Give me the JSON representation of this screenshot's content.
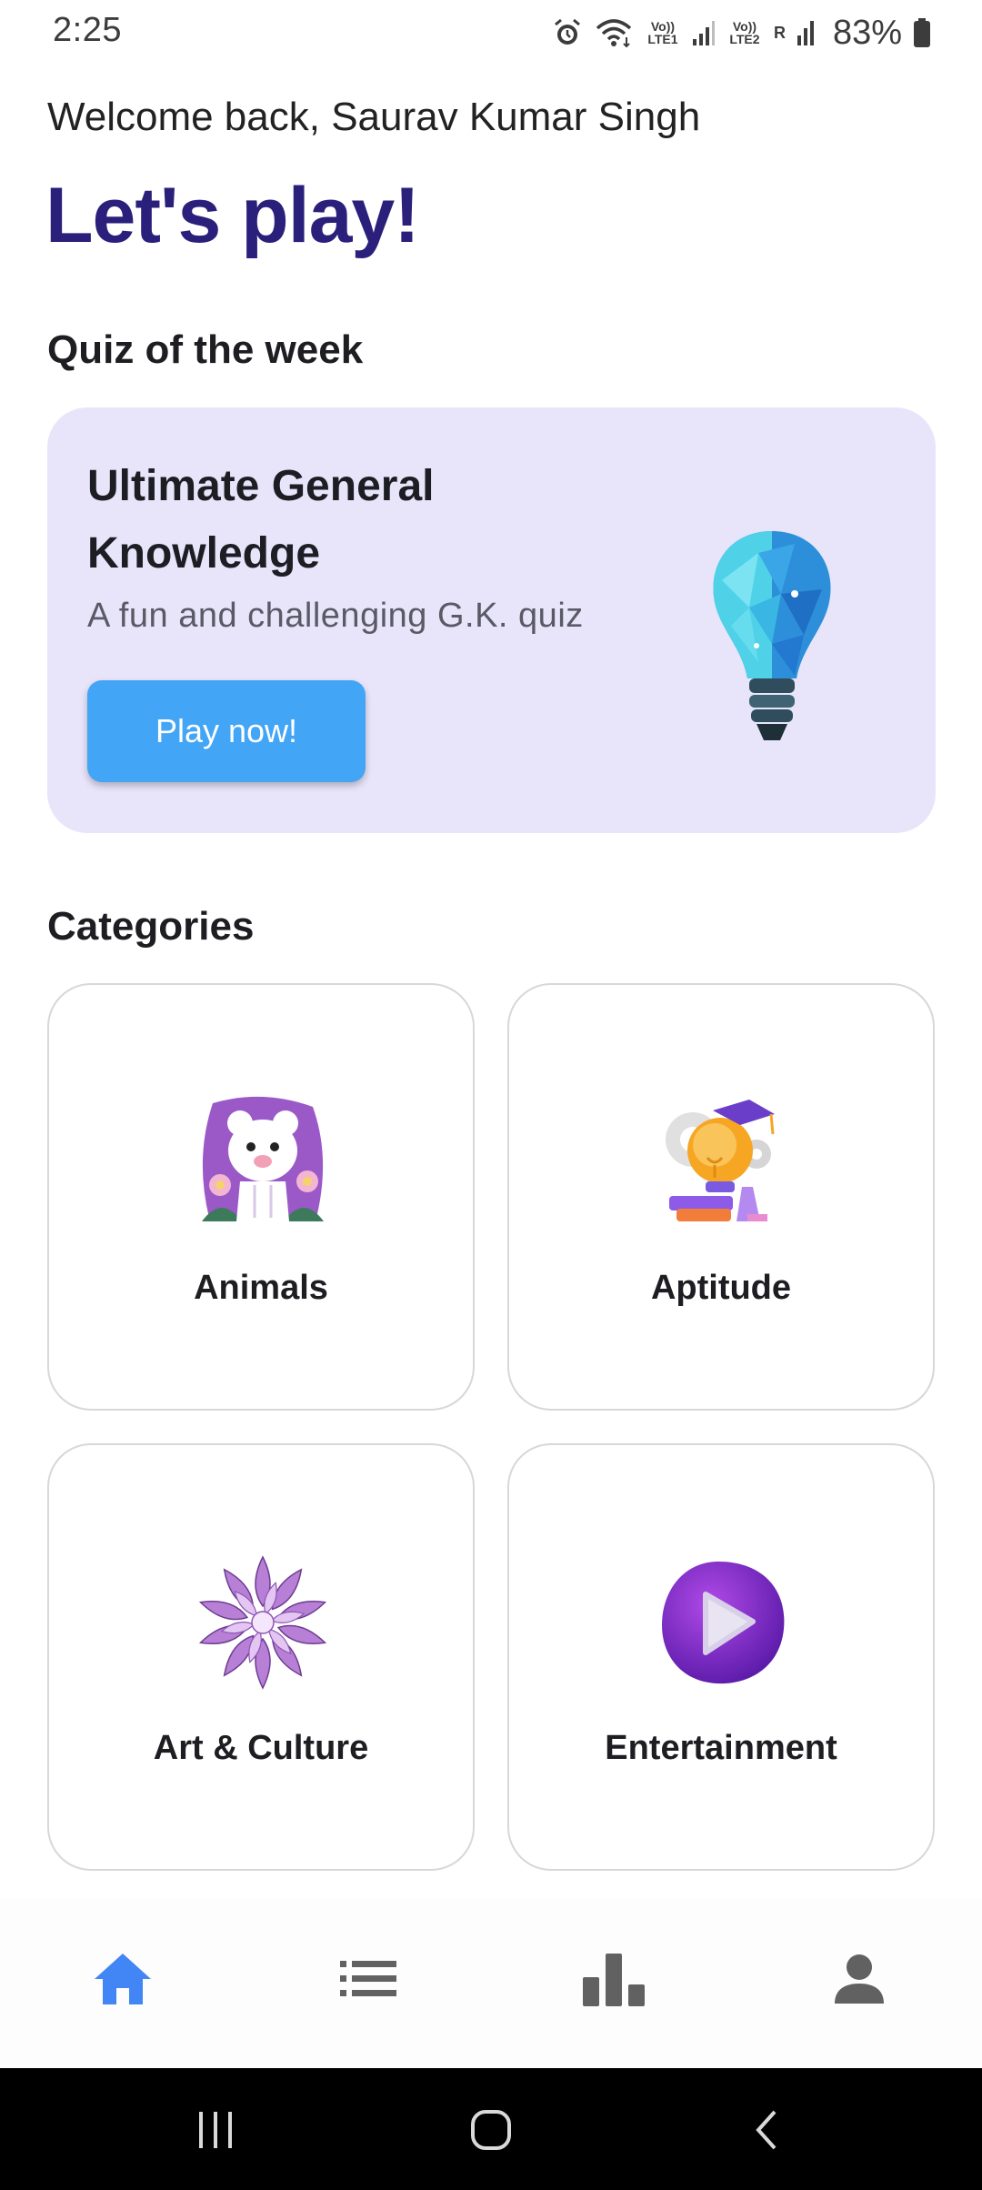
{
  "status_bar": {
    "time": "2:25",
    "sim1_tag": "Vo)) LTE1",
    "sim2_tag": "Vo)) LTE2",
    "roaming": "R",
    "battery": "83%",
    "icons": [
      "alarm-icon",
      "wifi-icon",
      "signal-icon",
      "battery-icon"
    ]
  },
  "header": {
    "welcome": "Welcome back, Saurav Kumar Singh",
    "headline": "Let's play!"
  },
  "quiz_of_week": {
    "section_title": "Quiz of the week",
    "title": "Ultimate General Knowledge",
    "description": "A fun and challenging G.K. quiz",
    "button_label": "Play now!",
    "art": "lightbulb-illustration"
  },
  "categories": {
    "section_title": "Categories",
    "items": [
      {
        "label": "Animals",
        "art": "bear-illustration"
      },
      {
        "label": "Aptitude",
        "art": "lightbulb-graduation-illustration"
      },
      {
        "label": "Art & Culture",
        "art": "lotus-illustration"
      },
      {
        "label": "Entertainment",
        "art": "play-button-illustration"
      }
    ]
  },
  "bottom_nav": {
    "items": [
      {
        "icon": "home-icon",
        "active": true
      },
      {
        "icon": "list-icon",
        "active": false
      },
      {
        "icon": "leaderboard-icon",
        "active": false
      },
      {
        "icon": "profile-icon",
        "active": false
      }
    ],
    "active_color": "#4285f4",
    "inactive_color": "#616161"
  },
  "system_nav": {
    "items": [
      "recent-apps-icon",
      "home-circle-icon",
      "back-icon"
    ]
  },
  "colors": {
    "headline": "#2a1f7a",
    "card_bg": "#e8e5fb",
    "button": "#42a5f5"
  }
}
